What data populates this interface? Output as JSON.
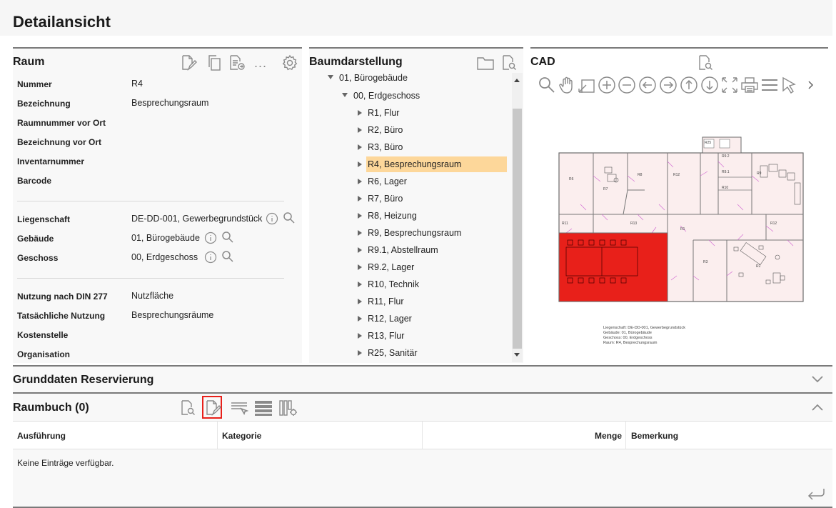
{
  "page": {
    "title": "Detailansicht"
  },
  "raum": {
    "title": "Raum",
    "props": [
      {
        "label": "Nummer",
        "value": "R4"
      },
      {
        "label": "Bezeichnung",
        "value": "Besprechungsraum"
      },
      {
        "label": "Raumnummer vor Ort",
        "value": ""
      },
      {
        "label": "Bezeichnung vor Ort",
        "value": ""
      },
      {
        "label": "Inventarnummer",
        "value": ""
      },
      {
        "label": "Barcode",
        "value": ""
      },
      {
        "label": "Liegenschaft",
        "value": "DE-DD-001, Gewerbegrundstück"
      },
      {
        "label": "Gebäude",
        "value": "01, Bürogebäude"
      },
      {
        "label": "Geschoss",
        "value": "00, Erdgeschoss"
      },
      {
        "label": "Nutzung nach DIN 277",
        "value": "Nutzfläche"
      },
      {
        "label": "Tatsächliche Nutzung",
        "value": "Besprechungsräume"
      },
      {
        "label": "Kostenstelle",
        "value": ""
      },
      {
        "label": "Organisation",
        "value": ""
      }
    ],
    "more_label": "..."
  },
  "baum": {
    "title": "Baumdarstellung",
    "items": [
      {
        "label": "01, Bürogebäude",
        "level": 0,
        "open": true
      },
      {
        "label": "00, Erdgeschoss",
        "level": 1,
        "open": true
      },
      {
        "label": "R1, Flur",
        "level": 2
      },
      {
        "label": "R2, Büro",
        "level": 2
      },
      {
        "label": "R3, Büro",
        "level": 2
      },
      {
        "label": "R4, Besprechungsraum",
        "level": 2,
        "selected": true
      },
      {
        "label": "R6, Lager",
        "level": 2
      },
      {
        "label": "R7, Büro",
        "level": 2
      },
      {
        "label": "R8, Heizung",
        "level": 2
      },
      {
        "label": "R9, Besprechungsraum",
        "level": 2
      },
      {
        "label": "R9.1, Abstellraum",
        "level": 2
      },
      {
        "label": "R9.2, Lager",
        "level": 2
      },
      {
        "label": "R10, Technik",
        "level": 2
      },
      {
        "label": "R11, Flur",
        "level": 2
      },
      {
        "label": "R12, Lager",
        "level": 2
      },
      {
        "label": "R13, Flur",
        "level": 2
      },
      {
        "label": "R25, Sanitär",
        "level": 2
      }
    ]
  },
  "cad": {
    "title": "CAD",
    "plan_rooms": [
      "R6",
      "R7",
      "R8",
      "R12",
      "R9",
      "R9.1",
      "R9.2",
      "R25",
      "R10",
      "R13",
      "R11",
      "R1",
      "R12",
      "R3",
      "R2"
    ],
    "legend": [
      "Liegenschaft: DE-DD-001, Gewerbegrundstück",
      "Gebäude: 01, Bürogebäude",
      "Geschoss: 00, Erdgeschoss",
      "Raum: R4, Besprechungsraum"
    ],
    "highlight_color": "#e8201a"
  },
  "reservierung": {
    "title": "Grunddaten Reservierung"
  },
  "raumbuch": {
    "title": "Raumbuch (0)",
    "columns": [
      "Ausführung",
      "Kategorie",
      "Menge",
      "Bemerkung"
    ],
    "empty_text": "Keine Einträge verfügbar."
  },
  "colors": {
    "accent": "#e8201a",
    "selection": "#fdd79a",
    "icon": "#8a8a8a"
  }
}
